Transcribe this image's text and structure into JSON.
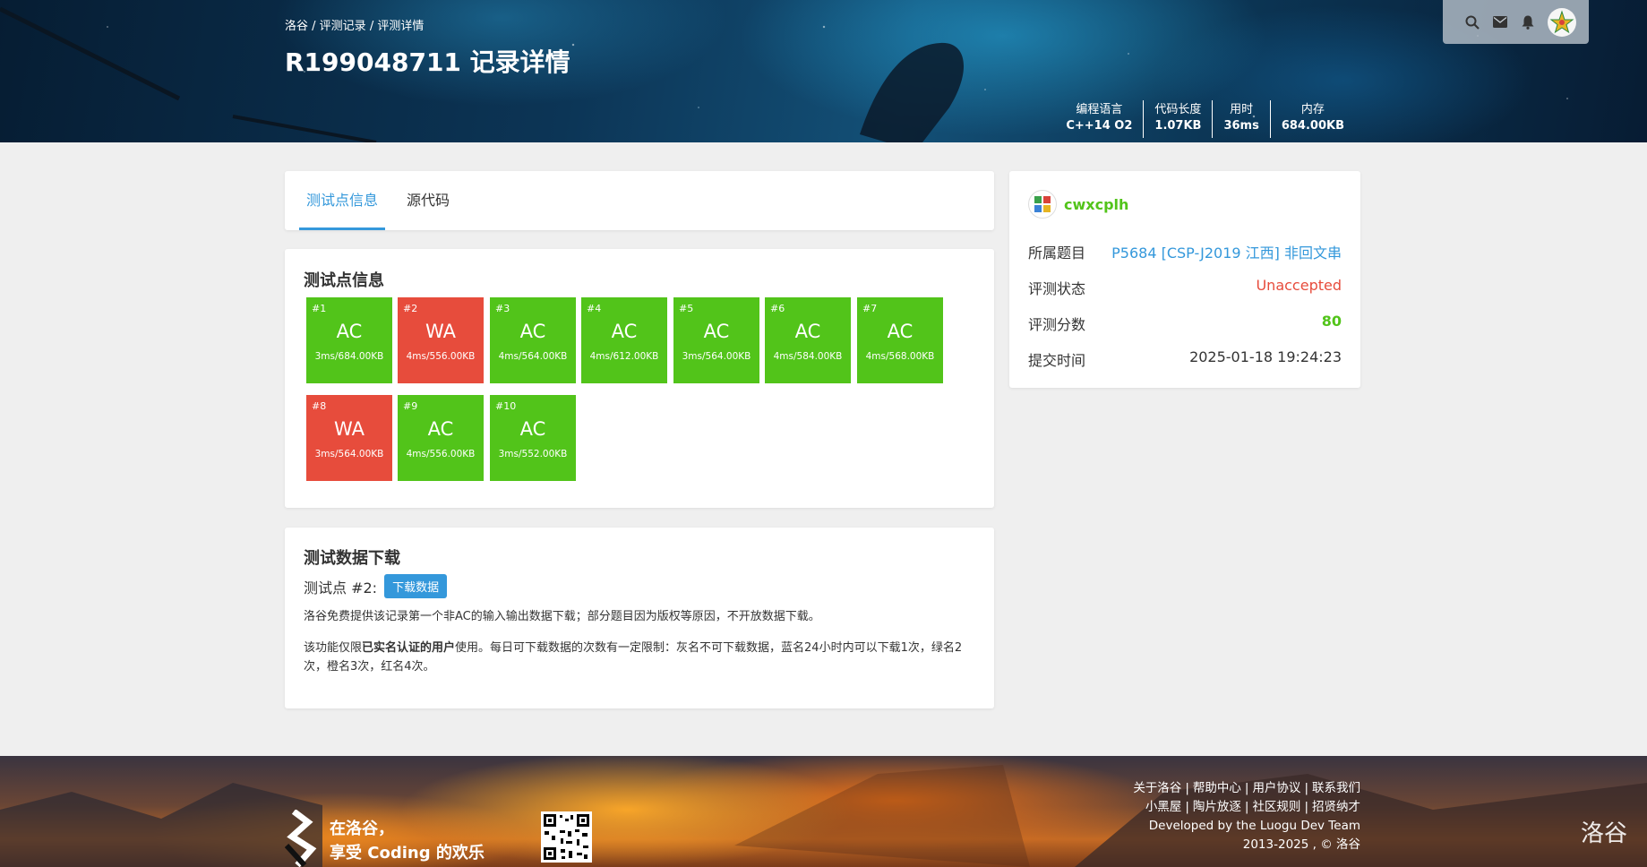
{
  "header": {
    "breadcrumb": [
      "洛谷",
      "评测记录",
      "评测详情"
    ],
    "breadcrumb_sep": " / ",
    "title": "R199048711 记录详情",
    "stats": [
      {
        "label": "编程语言",
        "value": "C++14 O2"
      },
      {
        "label": "代码长度",
        "value": "1.07KB"
      },
      {
        "label": "用时",
        "value": "36ms"
      },
      {
        "label": "内存",
        "value": "684.00KB"
      }
    ],
    "topbar_icons": [
      "search-icon",
      "mail-icon",
      "bell-icon"
    ]
  },
  "tabs": [
    {
      "label": "测试点信息",
      "active": true
    },
    {
      "label": "源代码",
      "active": false
    }
  ],
  "cases_section": {
    "title": "测试点信息",
    "cases": [
      {
        "id": "#1",
        "status": "AC",
        "info": "3ms/684.00KB"
      },
      {
        "id": "#2",
        "status": "WA",
        "info": "4ms/556.00KB"
      },
      {
        "id": "#3",
        "status": "AC",
        "info": "4ms/564.00KB"
      },
      {
        "id": "#4",
        "status": "AC",
        "info": "4ms/612.00KB"
      },
      {
        "id": "#5",
        "status": "AC",
        "info": "3ms/564.00KB"
      },
      {
        "id": "#6",
        "status": "AC",
        "info": "4ms/584.00KB"
      },
      {
        "id": "#7",
        "status": "AC",
        "info": "4ms/568.00KB"
      },
      {
        "id": "#8",
        "status": "WA",
        "info": "3ms/564.00KB"
      },
      {
        "id": "#9",
        "status": "AC",
        "info": "4ms/556.00KB"
      },
      {
        "id": "#10",
        "status": "AC",
        "info": "3ms/552.00KB"
      }
    ]
  },
  "download": {
    "title": "测试数据下载",
    "case_label": "测试点 #2:",
    "button": "下载数据",
    "note1": "洛谷免费提供该记录第一个非AC的输入输出数据下载；部分题目因为版权等原因，不开放数据下载。",
    "note2_pre": "该功能仅限",
    "note2_bold": "已实名认证的用户",
    "note2_post": "使用。每日可下载数据的次数有一定限制：灰名不可下载数据，蓝名24小时内可以下载1次，绿名2次，橙名3次，红名4次。"
  },
  "side": {
    "username": "cwxcplh",
    "rows": {
      "problem_label": "所属题目",
      "problem_value": "P5684 [CSP-J2019 江西] 非回文串",
      "status_label": "评测状态",
      "status_value": "Unaccepted",
      "score_label": "评测分数",
      "score_value": "80",
      "time_label": "提交时间",
      "time_value": "2025-01-18 19:24:23"
    }
  },
  "footer": {
    "slogan_line1": "在洛谷，",
    "slogan_line2": "享受 Coding 的欢乐",
    "links_row1": [
      "关于洛谷",
      "帮助中心",
      "用户协议",
      "联系我们"
    ],
    "links_row2": [
      "小黑屋",
      "陶片放逐",
      "社区规则",
      "招贤纳才"
    ],
    "developed_by": "Developed by the ",
    "team": "Luogu Dev Team",
    "copyright": "2013-2025 , © 洛谷",
    "brand": "洛谷"
  },
  "colors": {
    "ac": "#52c41a",
    "wa": "#e74c3c",
    "link": "#3498db"
  }
}
